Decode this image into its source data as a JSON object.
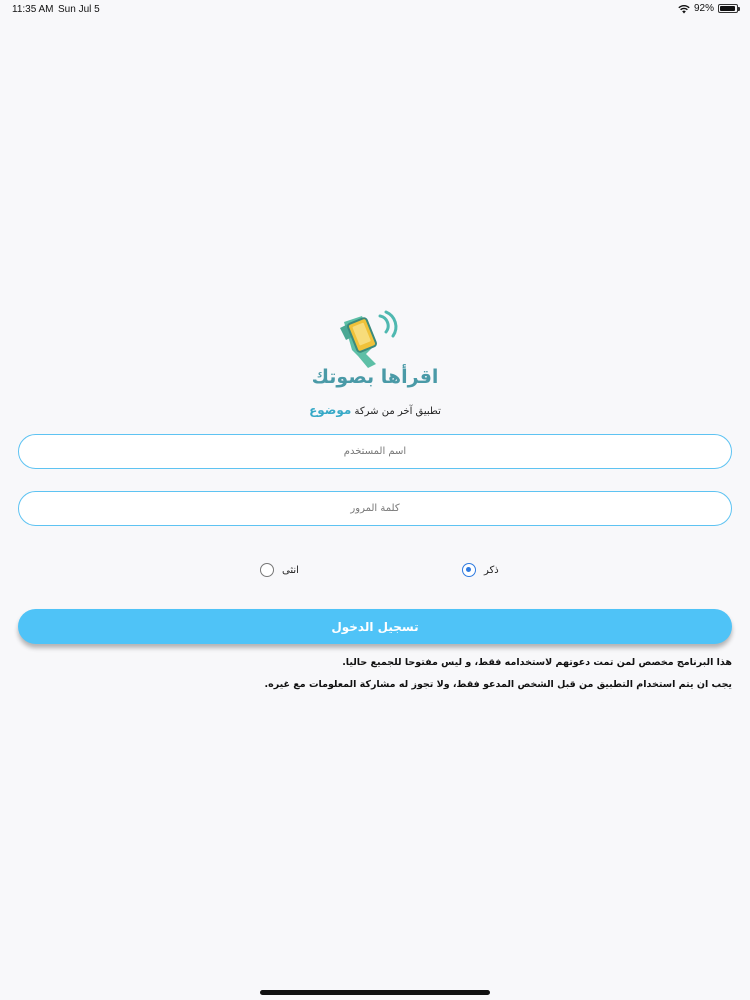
{
  "status_bar": {
    "time": "11:35 AM",
    "date": "Sun Jul 5",
    "battery": "92%",
    "battery_level": 0.92
  },
  "logo": {
    "icon": "hand-phone-speaking-icon",
    "title": "اقرأها بصوتك",
    "tagline_prefix": "تطبيق آخر من شركة",
    "tagline_brand": "موضوع"
  },
  "form": {
    "username_placeholder": "اسم المستخدم",
    "password_placeholder": "كلمة المرور",
    "gender": {
      "male_label": "ذكر",
      "female_label": "انثى",
      "selected": "male"
    },
    "login_label": "تسجيل الدخول"
  },
  "notices": {
    "line1": "هذا البرنامج مخصص لمن تمت دعوتهم لاستخدامه فقط، و ليس مفتوحا للجميع حاليا.",
    "line2": "يجب ان يتم استخدام التطبيق من قبل الشخص المدعو فقط، ولا تجوز له مشاركة المعلومات مع غيره."
  },
  "colors": {
    "accent": "#4fc3f7",
    "field_border": "#5ec3f2",
    "title": "#4a9aa7",
    "brand": "#37a9c7",
    "radio": "#2f7be0"
  }
}
